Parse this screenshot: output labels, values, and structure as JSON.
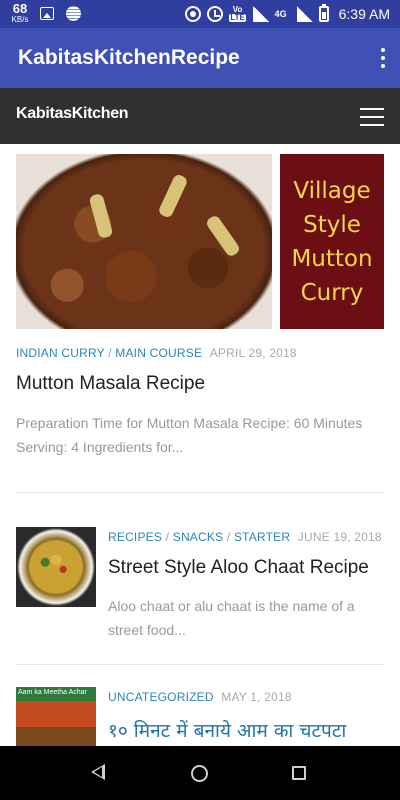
{
  "status_bar": {
    "speed_value": "68",
    "speed_unit": "KB/s",
    "network_label": "4G",
    "volte_label": "Vo",
    "lte_label": "LTE",
    "time": "6:39 AM"
  },
  "app_bar": {
    "title": "KabitasKitchenRecipe"
  },
  "site_header": {
    "logo": "KabitasKitchen"
  },
  "posts": [
    {
      "image_text": "Village\nStyle\nMutton\nCurry",
      "categories": [
        "INDIAN CURRY",
        "MAIN COURSE"
      ],
      "date": "APRIL 29, 2018",
      "title": "Mutton Masala Recipe",
      "excerpt_line1": "Preparation Time for Mutton Masala Recipe: 60 Minutes",
      "excerpt_line2": "Serving: 4 Ingredients for..."
    },
    {
      "categories": [
        "RECIPES",
        "SNACKS",
        "STARTER"
      ],
      "date": "JUNE 19, 2018",
      "title": "Street Style Aloo Chaat Recipe",
      "excerpt_line1": "Aloo chaat or alu chaat is the name of a",
      "excerpt_line2": "street food..."
    },
    {
      "thumb_text": "Aam ka Meetha Achar",
      "categories": [
        "UNCATEGORIZED"
      ],
      "date": "MAY 1, 2018",
      "title": "१० मिनट में बनाये आम का चटपटा"
    }
  ],
  "separator": "/",
  "colors": {
    "status_bar": "#303f9f",
    "app_bar": "#3f51b5",
    "site_header": "#2f3030",
    "category_link": "#2a86b8",
    "image_label_bg": "#6b0f14",
    "image_label_text": "#f4d54a"
  }
}
